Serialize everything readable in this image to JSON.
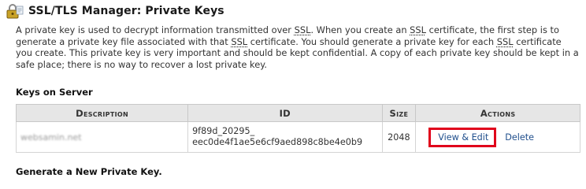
{
  "header": {
    "title": "SSL/TLS Manager: Private Keys",
    "icon": "ssl-lock-icon"
  },
  "intro": {
    "text_before_1": "A private key is used to decrypt information transmitted over ",
    "ssl": "SSL",
    "text_after_1": ". When you create an ",
    "text_after_2": " certificate, the first step is to generate a private key file associated with that ",
    "text_after_3": " certificate. You should generate a private key for each ",
    "text_after_4": " certificate you create. This private key is very important and should be kept confidential. A copy of each private key should be kept in a safe place; there is no way to recover a lost private key."
  },
  "keys_section": {
    "heading": "Keys on Server",
    "columns": {
      "description": "Description",
      "id": "ID",
      "size": "Size",
      "actions": "Actions"
    },
    "rows": [
      {
        "description": "websamin.net",
        "id_line1": "9f89d_20295_",
        "id_line2": "eec0de4f1ae5e6cf9aed898c8be4e0b9",
        "size": "2048",
        "view_edit": "View & Edit",
        "delete": "Delete"
      }
    ]
  },
  "generate_section": {
    "heading": "Generate a New Private Key."
  },
  "colors": {
    "highlight_border": "#e0001b",
    "link": "#1f4e8c",
    "header_bg": "#e6e6e6"
  }
}
